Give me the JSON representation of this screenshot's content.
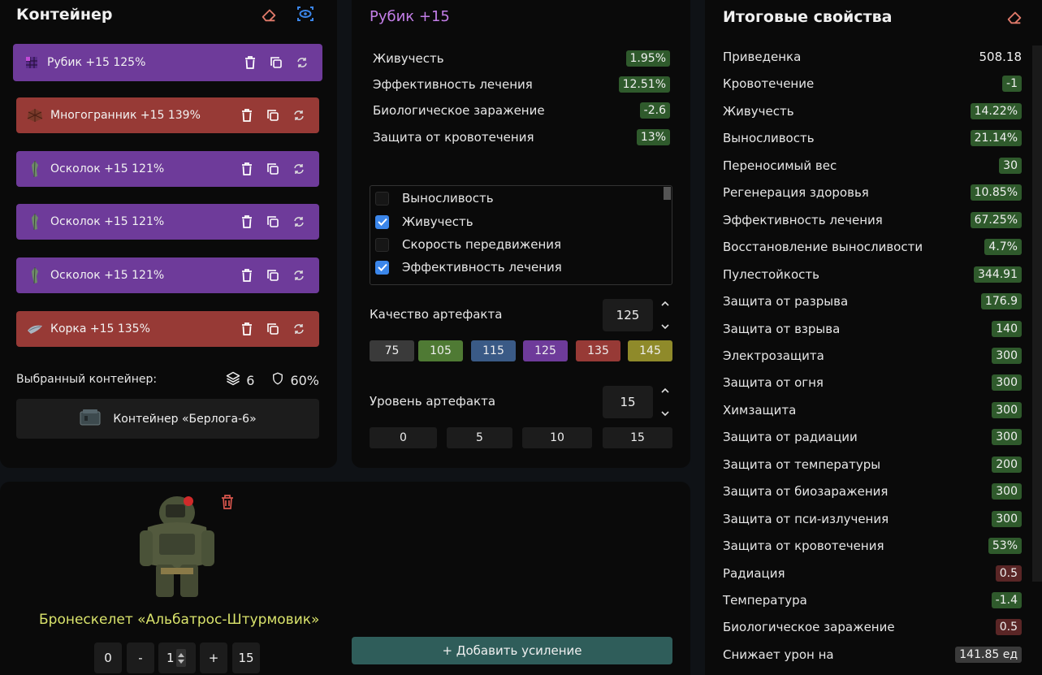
{
  "container": {
    "title": "Контейнер",
    "artifacts": [
      {
        "name": "Рубик",
        "level": "+15",
        "quality": "125%",
        "color": "purple",
        "icon": "cube-icon"
      },
      {
        "name": "Многогранник",
        "level": "+15",
        "quality": "139%",
        "color": "red",
        "icon": "polyhedron-icon"
      },
      {
        "name": "Осколок",
        "level": "+15",
        "quality": "121%",
        "color": "purple",
        "icon": "shard-icon"
      },
      {
        "name": "Осколок",
        "level": "+15",
        "quality": "121%",
        "color": "purple",
        "icon": "shard-icon"
      },
      {
        "name": "Осколок",
        "level": "+15",
        "quality": "121%",
        "color": "purple",
        "icon": "shard-icon"
      },
      {
        "name": "Корка",
        "level": "+15",
        "quality": "135%",
        "color": "red",
        "icon": "crust-icon"
      }
    ],
    "selected_label": "Выбранный контейнер:",
    "slots": "6",
    "protection": "60%",
    "container_name": "Контейнер «Берлога-6»"
  },
  "artifact": {
    "title": "Рубик +15",
    "stats": [
      {
        "label": "Живучесть",
        "value": "1.95%"
      },
      {
        "label": "Эффективность лечения",
        "value": "12.51%"
      },
      {
        "label": "Биологическое заражение",
        "value": "-2.6"
      },
      {
        "label": "Защита от кровотечения",
        "value": "13%"
      }
    ],
    "checklist": [
      {
        "label": "Выносливость",
        "checked": false
      },
      {
        "label": "Живучесть",
        "checked": true
      },
      {
        "label": "Скорость передвижения",
        "checked": false
      },
      {
        "label": "Эффективность лечения",
        "checked": true
      }
    ],
    "quality_label": "Качество артефакта",
    "quality_value": "125",
    "quality_options": [
      {
        "label": "75",
        "color": "#3a3a3a"
      },
      {
        "label": "105",
        "color": "#4f7a34"
      },
      {
        "label": "115",
        "color": "#3a5a86"
      },
      {
        "label": "125",
        "color": "#6e3b9a"
      },
      {
        "label": "135",
        "color": "#973a36"
      },
      {
        "label": "145",
        "color": "#8f8a2a"
      }
    ],
    "level_label": "Уровень артефакта",
    "level_value": "15",
    "level_options": [
      "0",
      "5",
      "10",
      "15"
    ]
  },
  "armor": {
    "name": "Бронескелет «Альбатрос-Штурмовик»",
    "btn_zero": "0",
    "btn_minus": "-",
    "level_input": "1",
    "btn_plus": "+",
    "btn_max": "15",
    "add_boost": "+ Добавить усиление"
  },
  "properties": {
    "title": "Итоговые свойства",
    "items": [
      {
        "label": "Приведенка",
        "value": "508.18",
        "style": "plain"
      },
      {
        "label": "Кровотечение",
        "value": "-1",
        "style": "green"
      },
      {
        "label": "Живучесть",
        "value": "14.22%",
        "style": "green"
      },
      {
        "label": "Выносливость",
        "value": "21.14%",
        "style": "green"
      },
      {
        "label": "Переносимый вес",
        "value": "30",
        "style": "green"
      },
      {
        "label": "Регенерация здоровья",
        "value": "10.85%",
        "style": "green"
      },
      {
        "label": "Эффективность лечения",
        "value": "67.25%",
        "style": "green"
      },
      {
        "label": "Восстановление выносливости",
        "value": "4.7%",
        "style": "green"
      },
      {
        "label": "Пулестойкость",
        "value": "344.91",
        "style": "green"
      },
      {
        "label": "Защита от разрыва",
        "value": "176.9",
        "style": "green"
      },
      {
        "label": "Защита от взрыва",
        "value": "140",
        "style": "green"
      },
      {
        "label": "Электрозащита",
        "value": "300",
        "style": "green"
      },
      {
        "label": "Защита от огня",
        "value": "300",
        "style": "green"
      },
      {
        "label": "Химзащита",
        "value": "300",
        "style": "green"
      },
      {
        "label": "Защита от радиации",
        "value": "300",
        "style": "green"
      },
      {
        "label": "Защита от температуры",
        "value": "200",
        "style": "green"
      },
      {
        "label": "Защита от биозаражения",
        "value": "300",
        "style": "green"
      },
      {
        "label": "Защита от пси-излучения",
        "value": "300",
        "style": "green"
      },
      {
        "label": "Защита от кровотечения",
        "value": "53%",
        "style": "green"
      },
      {
        "label": "Радиация",
        "value": "0.5",
        "style": "darkred"
      },
      {
        "label": "Температура",
        "value": "-1.4",
        "style": "green"
      },
      {
        "label": "Биологическое заражение",
        "value": "0.5",
        "style": "darkred"
      },
      {
        "label": "Снижает урон на",
        "value": "141.85 ед",
        "style": "grey"
      }
    ]
  }
}
